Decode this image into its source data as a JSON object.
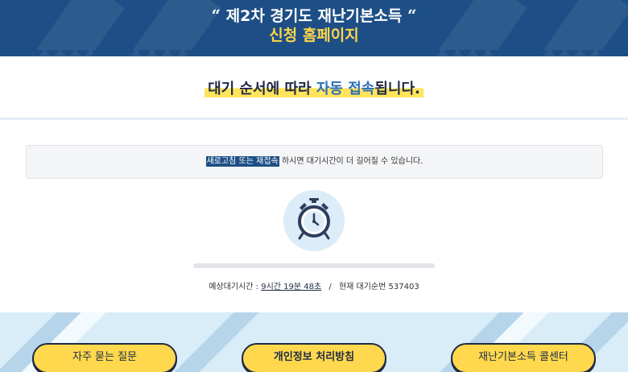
{
  "header": {
    "open_quote": "“",
    "title": "제2차 경기도 재난기본소득",
    "close_quote": "“",
    "subtitle": "신청 홈페이지"
  },
  "notice": {
    "part1": "대기 순서에 따라 ",
    "part2": "자동 접속",
    "part3": "됩니다."
  },
  "warning": {
    "highlight": "새로고침 또는 재접속",
    "rest": "하시면 대기시간이 더 길어질 수 있습니다."
  },
  "wait": {
    "label": "예상대기시간 : ",
    "estimated_time": "9시간 19분 48초",
    "separator": "/",
    "queue_label": "현재 대기순번",
    "queue_number": "537403",
    "progress_fraction": 0.0
  },
  "footer": {
    "buttons": [
      {
        "label": "자주 묻는 질문"
      },
      {
        "label": "개인정보 처리방침"
      },
      {
        "label": "재난기본소득 콜센터"
      }
    ]
  },
  "colors": {
    "header_bg": "#1d4f86",
    "subtitle": "#ffd54a",
    "highlight": "#ffe45c",
    "accent": "#2c6fb7",
    "footer_bg": "#d8edf8",
    "button_bg": "#ffd84d"
  },
  "icons": {
    "clock": "alarm-clock-icon"
  }
}
